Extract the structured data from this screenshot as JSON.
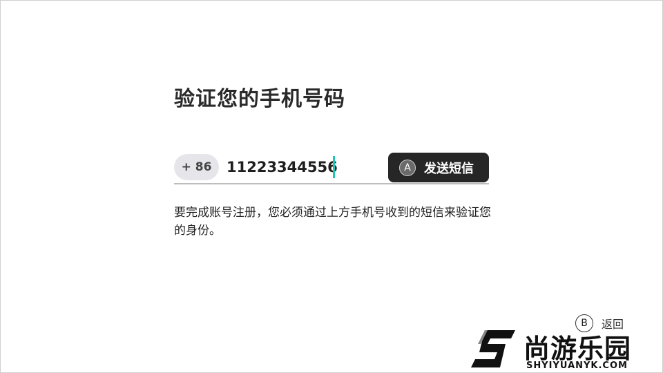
{
  "page": {
    "title": "验证您的手机号码",
    "description": "要完成账号注册，您必须通过上方手机号收到的短信来验证您的身份。"
  },
  "phone": {
    "country_code": "+ 86",
    "number": "11223344556"
  },
  "send_button": {
    "icon_letter": "A",
    "label": "发送短信"
  },
  "back": {
    "icon_letter": "B",
    "label": "返回"
  },
  "watermark": {
    "name_cn": "尚游乐园",
    "domain": "SHYIYUANYK.COM"
  },
  "colors": {
    "caret": "#1ec6b4",
    "button_bg": "#262626",
    "pill_bg": "#e6e6ea"
  }
}
